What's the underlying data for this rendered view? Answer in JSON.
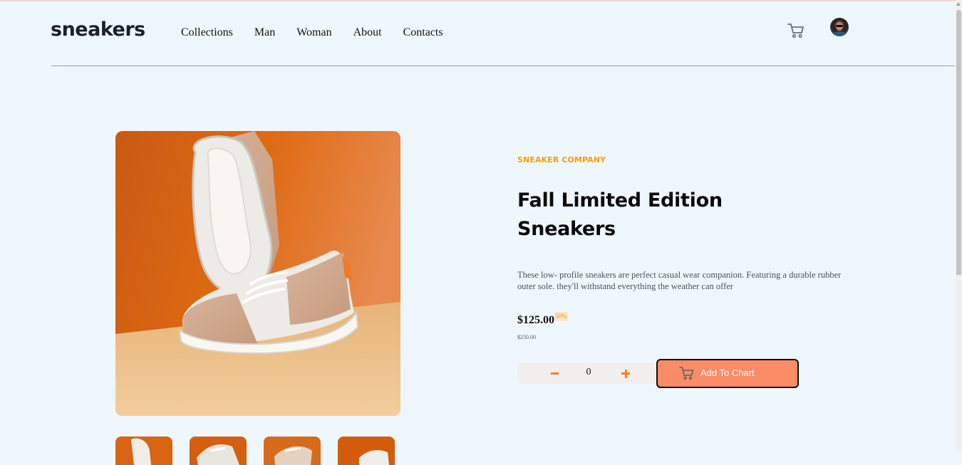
{
  "header": {
    "logo": "sneakers",
    "nav": [
      "Collections",
      "Man",
      "Woman",
      "About",
      "Contacts"
    ]
  },
  "product": {
    "company": "SNEAKER COMPANY",
    "title_line1": "Fall Limited Edition",
    "title_line2": "Sneakers",
    "description": "These low- profile sneakers are perfect casual wear companion. Featuring a durable rubber outer sole. they'll withstand everything the weather can offer",
    "price": "$125.00",
    "discount": "50%",
    "old_price": "$250.00"
  },
  "cart": {
    "quantity": "0",
    "add_label": "Add To Chart"
  },
  "colors": {
    "accent_orange": "#ff7d1a",
    "button_bg": "#fa8c66",
    "company_text": "#f0a10c",
    "page_bg": "#eff7fe"
  },
  "icons": [
    "cart-icon",
    "avatar",
    "minus-icon",
    "plus-icon",
    "cart-button-icon"
  ]
}
